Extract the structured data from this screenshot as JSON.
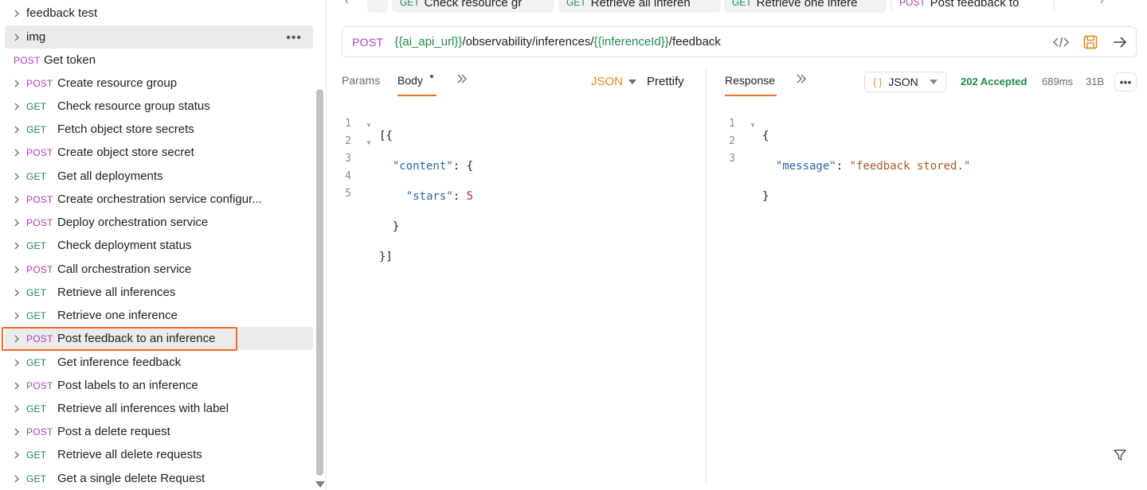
{
  "sidebar": {
    "folders": [
      {
        "label": "feedback test"
      },
      {
        "label": "img"
      }
    ],
    "top_request": {
      "method": "POST",
      "label": "Get token"
    },
    "requests": [
      {
        "method": "POST",
        "label": "Create resource group"
      },
      {
        "method": "GET",
        "label": "Check resource group status"
      },
      {
        "method": "GET",
        "label": "Fetch object store secrets"
      },
      {
        "method": "POST",
        "label": "Create object store secret"
      },
      {
        "method": "GET",
        "label": "Get all deployments"
      },
      {
        "method": "POST",
        "label": "Create orchestration service configur..."
      },
      {
        "method": "POST",
        "label": "Deploy orchestration service"
      },
      {
        "method": "GET",
        "label": "Check deployment status"
      },
      {
        "method": "POST",
        "label": "Call orchestration service"
      },
      {
        "method": "GET",
        "label": "Retrieve all inferences"
      },
      {
        "method": "GET",
        "label": "Retrieve one inference"
      },
      {
        "method": "POST",
        "label": "Post feedback to an inference"
      },
      {
        "method": "GET",
        "label": "Get inference feedback"
      },
      {
        "method": "POST",
        "label": "Post labels to an inference"
      },
      {
        "method": "GET",
        "label": "Retrieve all inferences with label"
      },
      {
        "method": "POST",
        "label": "Post a delete request"
      },
      {
        "method": "GET",
        "label": "Retrieve all delete requests"
      },
      {
        "method": "GET",
        "label": "Get a single delete Request"
      }
    ]
  },
  "tabs": [
    {
      "method": "GET",
      "label": "Check resource gr"
    },
    {
      "method": "GET",
      "label": "Retrieve all inferen"
    },
    {
      "method": "GET",
      "label": "Retrieve one infere"
    },
    {
      "method": "POST",
      "label": "Post feedback to"
    }
  ],
  "url": {
    "method": "POST",
    "var1": "{{ai_api_url}}",
    "part1": "/observability/inferences/",
    "var2": "{{inferenceId}}",
    "part2": "/feedback"
  },
  "request": {
    "tab_params": "Params",
    "tab_body": "Body",
    "format": "JSON",
    "prettify": "Prettify",
    "line_numbers": [
      "1",
      "2",
      "3",
      "4",
      "5"
    ]
  },
  "response": {
    "tab_label": "Response",
    "format": "JSON",
    "format_icon": "{ }",
    "status": "202 Accepted",
    "time": "689ms",
    "size": "31B",
    "line_numbers": [
      "1",
      "2",
      "3"
    ]
  },
  "colors": {
    "post": "#ad3fb3",
    "get": "#1f8a4c",
    "accent": "#f26b21"
  }
}
